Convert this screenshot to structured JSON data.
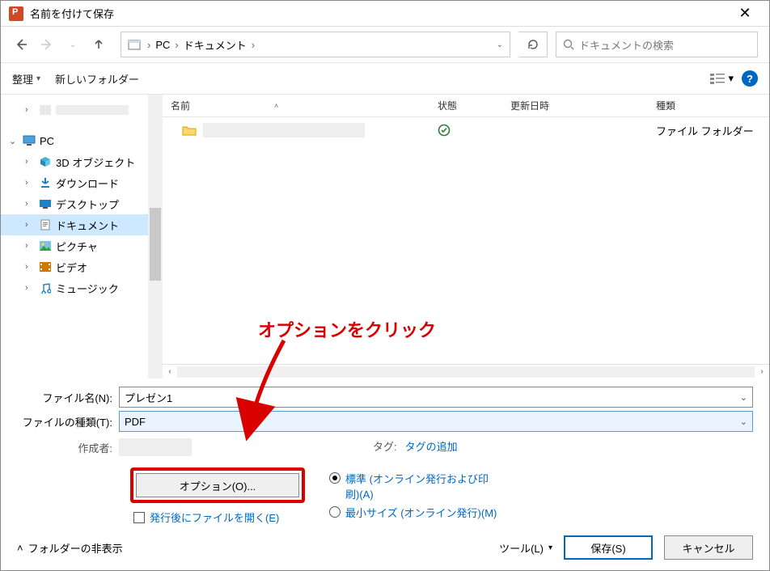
{
  "title": "名前を付けて保存",
  "breadcrumb": {
    "root": "PC",
    "folder": "ドキュメント"
  },
  "search_placeholder": "ドキュメントの検索",
  "toolbar": {
    "organize": "整理",
    "new_folder": "新しいフォルダー"
  },
  "columns": {
    "name": "名前",
    "status": "状態",
    "date": "更新日時",
    "type": "種類"
  },
  "sidebar": {
    "pc": "PC",
    "objects3d": "3D オブジェクト",
    "downloads": "ダウンロード",
    "desktop": "デスクトップ",
    "documents": "ドキュメント",
    "pictures": "ピクチャ",
    "videos": "ビデオ",
    "music": "ミュージック"
  },
  "file_row": {
    "type_label": "ファイル フォルダー"
  },
  "form": {
    "filename_label": "ファイル名(N):",
    "filename_value": "プレゼン1",
    "filetype_label": "ファイルの種類(T):",
    "filetype_value": "PDF",
    "author_label": "作成者:",
    "tag_label": "タグ:",
    "tag_link": "タグの追加"
  },
  "options": {
    "button": "オプション(O)...",
    "open_after": "発行後にファイルを開く(E)",
    "standard": "標準 (オンライン発行および印刷)(A)",
    "minimum": "最小サイズ (オンライン発行)(M)"
  },
  "bottom": {
    "hide_folders": "フォルダーの非表示",
    "tools": "ツール(L)",
    "save": "保存(S)",
    "cancel": "キャンセル"
  },
  "annotation": "オプションをクリック"
}
